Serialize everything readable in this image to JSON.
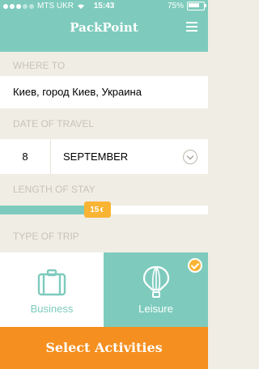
{
  "status_bar": {
    "carrier": "MTS UKR",
    "time": "15:43",
    "battery_percent": "75%"
  },
  "app": {
    "title": "PackPoint"
  },
  "where_to": {
    "label": "WHERE TO",
    "value": "Киев, город Киев, Украина"
  },
  "date_of_travel": {
    "label": "DATE OF TRAVEL",
    "day": "8",
    "month": "SEPTEMBER"
  },
  "length_of_stay": {
    "label": "LENGTH OF STAY",
    "nights": "15",
    "slider_fraction": 0.47
  },
  "type_of_trip": {
    "label": "TYPE OF TRIP",
    "options": [
      {
        "label": "Business",
        "selected": false
      },
      {
        "label": "Leisure",
        "selected": true
      }
    ]
  },
  "actions": {
    "select_activities": "Select Activities"
  },
  "colors": {
    "teal": "#7ecbbd",
    "orange": "#f58f1f",
    "yellow": "#f9b433",
    "label_gray": "#c9c3b6",
    "background": "#f0ede5"
  }
}
